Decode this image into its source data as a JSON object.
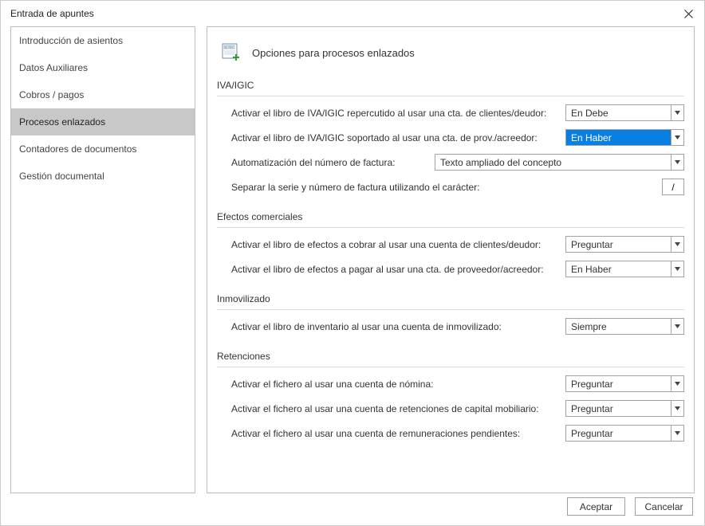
{
  "window": {
    "title": "Entrada de apuntes"
  },
  "sidebar": {
    "items": [
      {
        "label": "Introducción de asientos"
      },
      {
        "label": "Datos Auxiliares"
      },
      {
        "label": "Cobros / pagos"
      },
      {
        "label": "Procesos enlazados"
      },
      {
        "label": "Contadores de documentos"
      },
      {
        "label": "Gestión documental"
      }
    ]
  },
  "main": {
    "heading": "Opciones para procesos enlazados",
    "sections": {
      "iva": {
        "title": "IVA/IGIC",
        "row_repercutido": {
          "label": "Activar el libro de IVA/IGIC repercutido al usar una cta. de clientes/deudor:",
          "value": "En Debe"
        },
        "row_soportado": {
          "label": "Activar el libro de IVA/IGIC soportado al usar una cta. de prov./acreedor:",
          "value": "En Haber"
        },
        "row_autonum": {
          "label": "Automatización del número de factura:",
          "value": "Texto ampliado del concepto"
        },
        "row_separar": {
          "label": "Separar la serie y número de factura utilizando el carácter:",
          "value": "/"
        }
      },
      "efectos": {
        "title": "Efectos comerciales",
        "row_cobrar": {
          "label": "Activar el libro de efectos a cobrar al usar una cuenta de clientes/deudor:",
          "value": "Preguntar"
        },
        "row_pagar": {
          "label": "Activar el libro de efectos a pagar al usar una cta. de proveedor/acreedor:",
          "value": "En Haber"
        }
      },
      "inmovilizado": {
        "title": "Inmovilizado",
        "row_inventario": {
          "label": "Activar el libro de inventario al usar una cuenta de inmovilizado:",
          "value": "Siempre"
        }
      },
      "retenciones": {
        "title": "Retenciones",
        "row_nomina": {
          "label": "Activar el fichero al usar una cuenta de nómina:",
          "value": "Preguntar"
        },
        "row_capital": {
          "label": "Activar el fichero al usar una cuenta de retenciones de capital mobiliario:",
          "value": "Preguntar"
        },
        "row_remuneraciones": {
          "label": "Activar el fichero al usar una cuenta de remuneraciones pendientes:",
          "value": "Preguntar"
        }
      }
    }
  },
  "footer": {
    "accept": "Aceptar",
    "cancel": "Cancelar"
  }
}
